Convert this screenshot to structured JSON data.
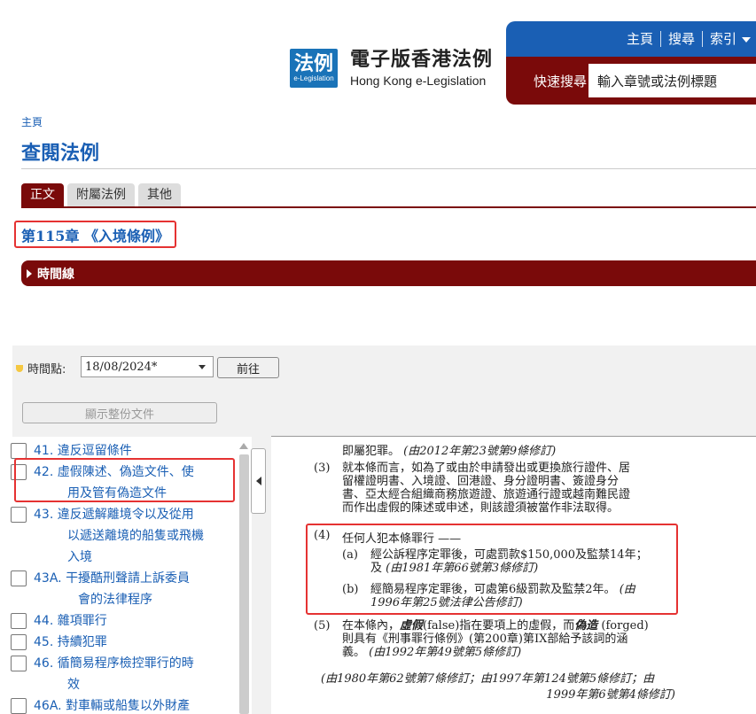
{
  "header": {
    "logo_zh": "法例",
    "logo_en": "e-Legislation",
    "site_title_zh": "電子版香港法例",
    "site_title_en": "Hong Kong e-Legislation",
    "nav": [
      "主頁",
      "搜尋",
      "索引"
    ],
    "quick_search_label": "快速搜尋",
    "quick_search_placeholder": "輸入章號或法例標題"
  },
  "breadcrumb": "主頁",
  "page_title": "查閱法例",
  "tabs": [
    "正文",
    "附屬法例",
    "其他"
  ],
  "chapter_title": "第115章 《入境條例》",
  "timeline_label": "時間線",
  "point_in_time_label": "時間點:",
  "point_in_time_value": "18/08/2024*",
  "go_button": "前往",
  "show_full_button": "顯示整份文件",
  "sections": [
    {
      "num": "41.",
      "lines": [
        "違反逗留條件"
      ]
    },
    {
      "num": "42.",
      "lines": [
        "虛假陳述、偽造文件、使",
        "用及管有偽造文件"
      ]
    },
    {
      "num": "43.",
      "lines": [
        "違反遞解離境令以及從用",
        "以遞送離境的船隻或飛機",
        "入境"
      ]
    },
    {
      "num": "43A.",
      "lines": [
        "干擾酷刑聲請上訴委員",
        "會的法律程序"
      ]
    },
    {
      "num": "44.",
      "lines": [
        "雜項罪行"
      ]
    },
    {
      "num": "45.",
      "lines": [
        "持續犯罪"
      ]
    },
    {
      "num": "46.",
      "lines": [
        "循簡易程序檢控罪行的時",
        "效"
      ]
    },
    {
      "num": "46A.",
      "lines": [
        "對車輛或船隻以外財產"
      ]
    }
  ],
  "content": {
    "intro_line": "即屬犯罪。",
    "intro_amend": "(由2012年第23號第9條修訂)",
    "s3_num": "(3)",
    "s3_lines": [
      "就本條而言，如為了或由於申請發出或更換旅行證件、居",
      "留權證明書、入境證、回港證、身分證明書、簽證身分",
      "書、亞太經合組織商務旅遊證、旅遊通行證或越南難民證",
      "而作出虛假的陳述或申述，則該證須被當作非法取得。"
    ],
    "s4_num": "(4)",
    "s4_head": "任何人犯本條罪行 ——",
    "s4a_num": "(a)",
    "s4a_line1": "經公訴程序定罪後，可處罰款$150,000及監禁14年；",
    "s4a_line2": "及",
    "s4a_amend": "(由1981年第66號第3條修訂)",
    "s4b_num": "(b)",
    "s4b_line1": "經簡易程序定罪後，可處第6級罰款及監禁2年。",
    "s4b_amend1": "(由",
    "s4b_amend2": "1996年第25號法律公告修訂)",
    "s5_num": "(5)",
    "s5_line1_a": "在本條內，",
    "s5_line1_b": "虛假",
    "s5_line1_c": "(false)指在要項上的虛假，而",
    "s5_line1_d": "偽造",
    "s5_line1_e": " (forged)",
    "s5_line2": "則具有《刑事罪行條例》(第200章)第IX部給予該詞的涵",
    "s5_line3": "義。",
    "s5_amend": "(由1992年第49號第5條修訂)",
    "footer_amend1": "(由1980年第62號第7條修訂；由1997年第124號第5條修訂；由",
    "footer_amend2": "1999年第6號第4條修訂)"
  },
  "colors": {
    "brand_blue": "#1a5fb4",
    "brand_maroon": "#7a0a0a",
    "highlight_red": "#e53232"
  }
}
